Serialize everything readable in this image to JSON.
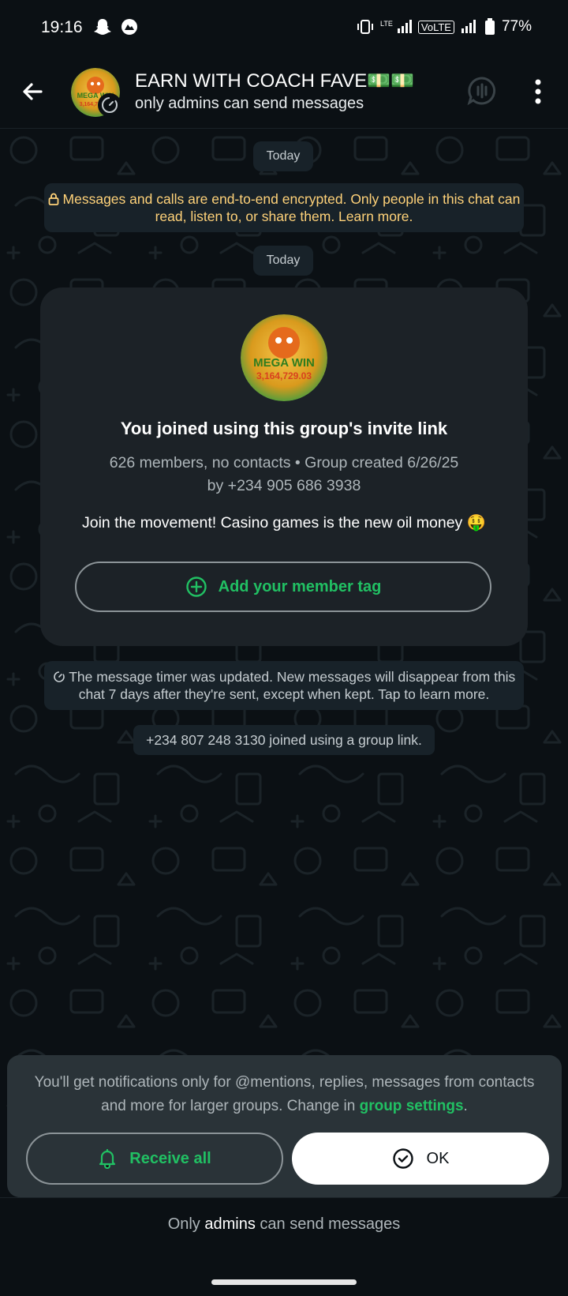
{
  "status_bar": {
    "time": "19:16",
    "battery": "77%",
    "network_label": "VoLTE"
  },
  "header": {
    "title": "EARN WITH COACH FAVE💵💵",
    "subtitle": "only admins can send messages",
    "avatar_text_top": "MEGA WIN",
    "avatar_text_bottom": "3,164,729.03"
  },
  "chat": {
    "date_chip_1": "Today",
    "date_chip_2": "Today",
    "encryption_notice": "Messages and calls are end-to-end encrypted. Only people in this chat can read, listen to, or share them. Learn more.",
    "card": {
      "title": "You joined using this group's invite link",
      "meta_line1": "626 members, no contacts • Group created 6/26/25",
      "meta_line2": "by +234 905 686 3938",
      "description": "Join the movement! Casino games is the new oil money 🤑",
      "tag_button": "Add your member tag"
    },
    "timer_notice": "The message timer was updated. New messages will disappear from this chat 7 days after they're sent, except when kept. Tap to learn more.",
    "join_notice": "+234 807 248 3130 joined using a group link."
  },
  "notification_panel": {
    "text_before": "You'll get notifications only for @mentions, replies, messages from contacts and more for larger groups. Change in ",
    "link": "group settings",
    "text_after": ".",
    "receive_all_button": "Receive all",
    "ok_button": "OK"
  },
  "footer": {
    "prefix": "Only ",
    "emphasis": "admins",
    "suffix": " can send messages"
  },
  "colors": {
    "background": "#0b1014",
    "accent_green": "#21c063",
    "bubble": "#182229",
    "encryption_text": "#ffd279"
  }
}
